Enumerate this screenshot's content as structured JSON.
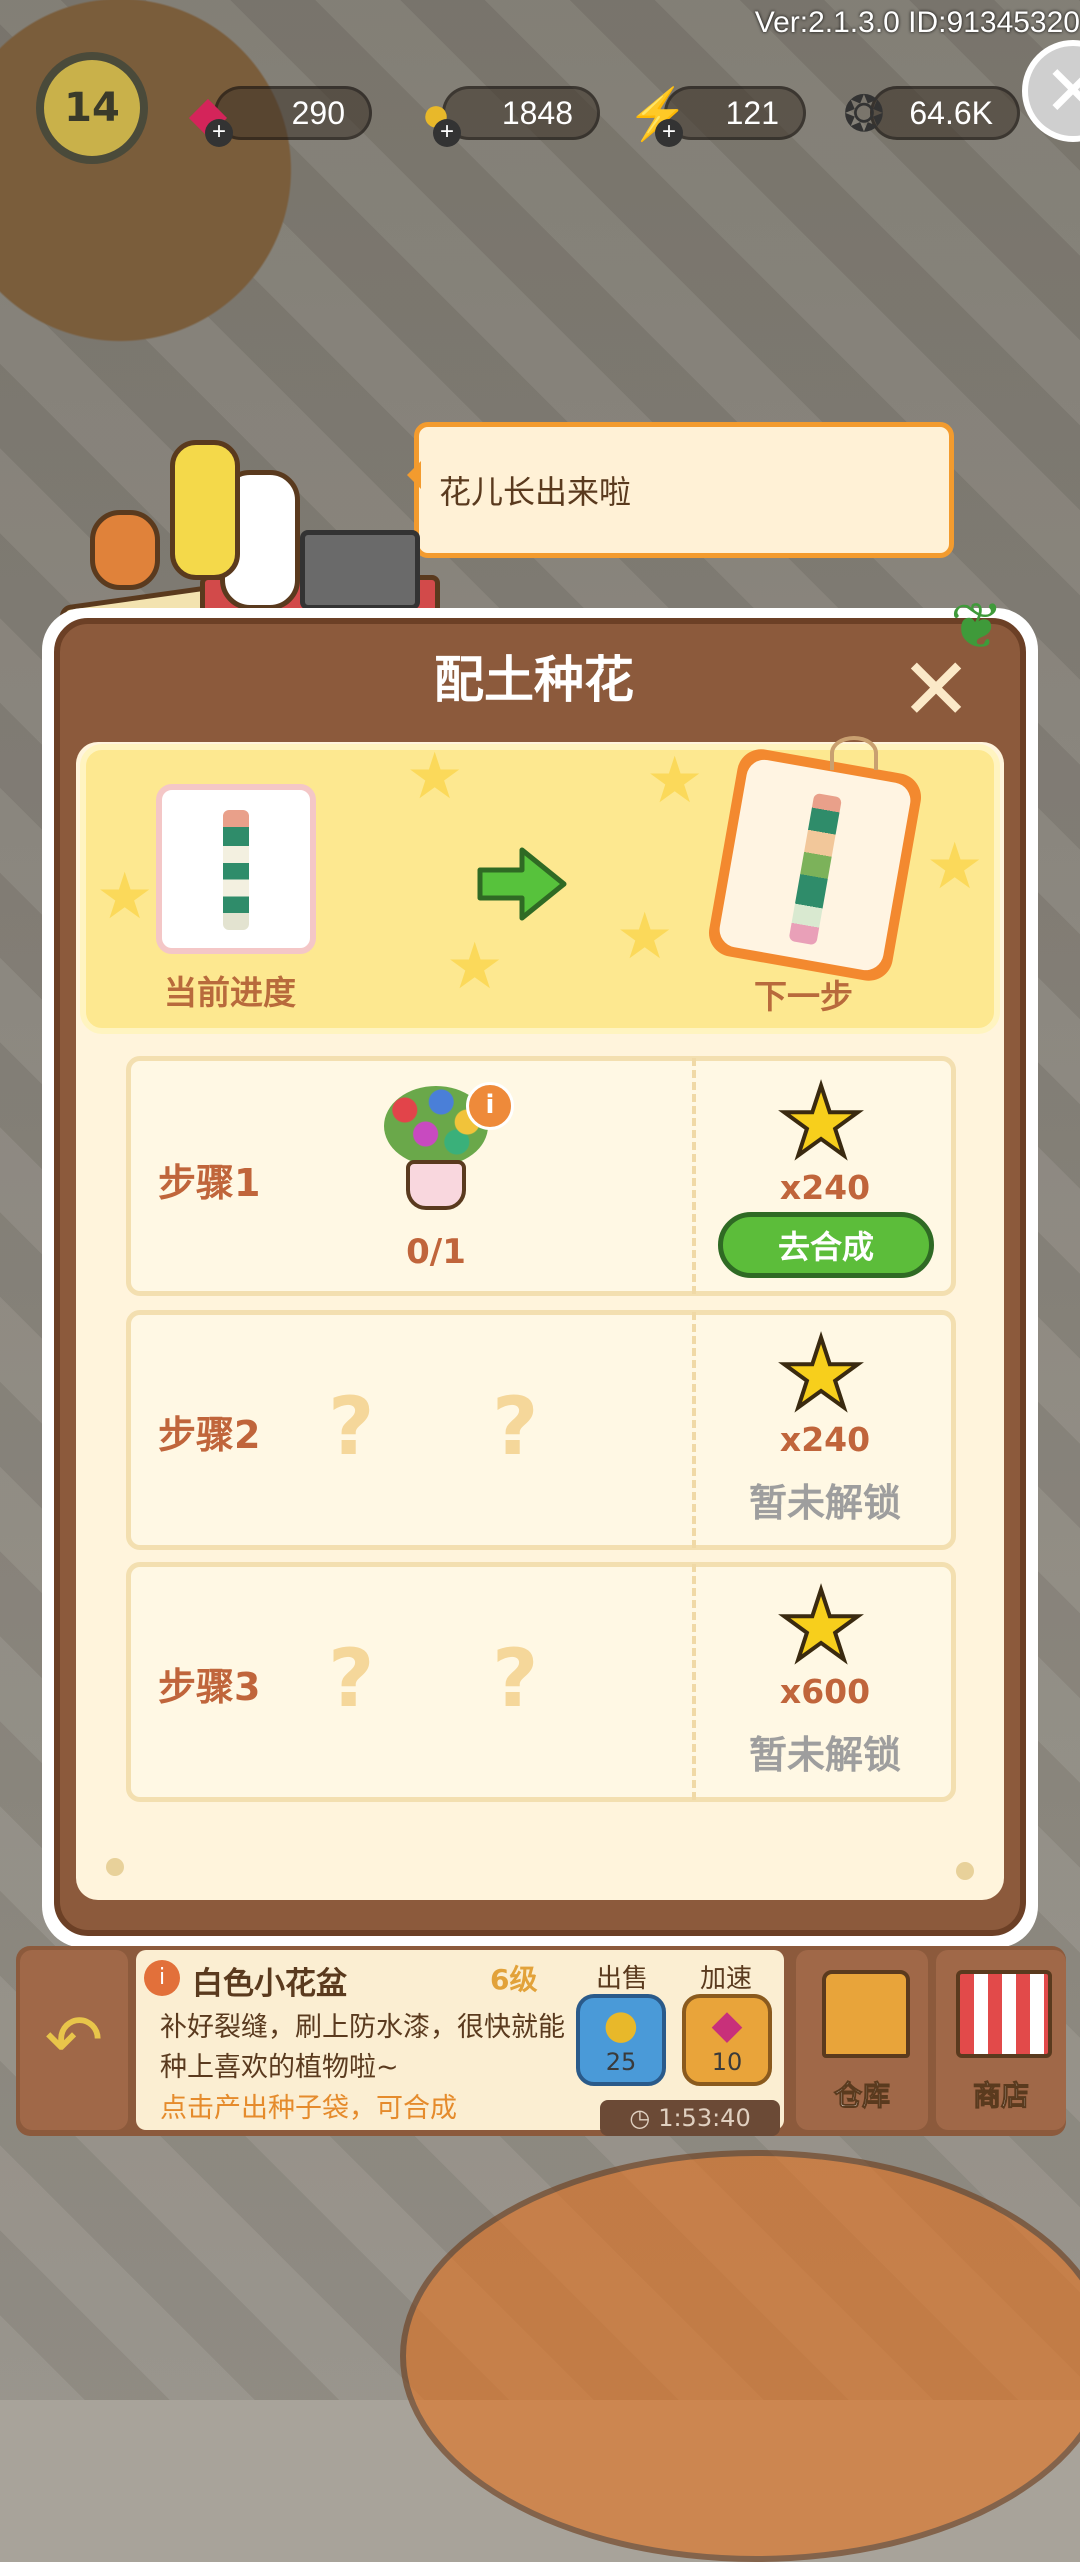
{
  "header": {
    "version": "Ver:2.1.3.0 ID:91345320",
    "level": "14",
    "gems": "290",
    "coins": "1848",
    "energy": "121",
    "seeds": "64.6K"
  },
  "bubble": {
    "text": "花儿长出来啦"
  },
  "dialog": {
    "title": "配土种花",
    "current_label": "当前进度",
    "next_label": "下一步",
    "steps": [
      {
        "name": "步骤1",
        "progress": "0/1",
        "reward": "x240",
        "action": "去合成"
      },
      {
        "name": "步骤2",
        "qmark": "?",
        "reward": "x240",
        "status": "暂未解锁"
      },
      {
        "name": "步骤3",
        "qmark": "?",
        "reward": "x600",
        "status": "暂未解锁"
      }
    ]
  },
  "checkout_sign": "checkout",
  "item_panel": {
    "title": "白色小花盆",
    "level": "6级",
    "desc": "补好裂缝，刷上防水漆，很快就能种上喜欢的植物啦~",
    "hint": "点击产出种子袋，可合成",
    "sell_label": "出售",
    "sell_value": "25",
    "speed_label": "加速",
    "speed_value": "10",
    "timer": "1:53:40"
  },
  "tiles": {
    "warehouse": "仓库",
    "shop": "商店"
  },
  "colors": {
    "accent": "#8c5a3c",
    "green": "#5cbd3a",
    "star": "#f7cf1c"
  }
}
